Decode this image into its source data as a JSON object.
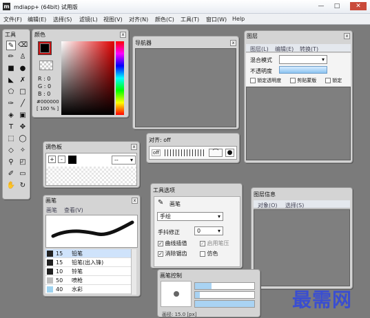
{
  "window": {
    "title": "mdiapp+ (64bit) 试用版",
    "icon_letter": "m",
    "minimize": "—",
    "maximize": "□",
    "close": "✕"
  },
  "menu": [
    "文件(F)",
    "编辑(E)",
    "选择(S)",
    "滤镜(L)",
    "视图(V)",
    "对齐(N)",
    "颜色(C)",
    "工具(T)",
    "窗口(W)",
    "Help"
  ],
  "tools_panel": {
    "title": "工具"
  },
  "color_panel": {
    "title": "颜色",
    "r": "R : 0",
    "g": "G : 0",
    "b": "B : 0",
    "hex": "#000000",
    "opacity": "[ 100 % ]"
  },
  "navigator": {
    "title": "导航器"
  },
  "layers": {
    "title": "图层",
    "tabs": [
      "图层(L)",
      "编辑(E)",
      "转换(T)"
    ],
    "blend_label": "混合模式",
    "opacity_label": "不透明度",
    "checks": [
      "锁定透明度",
      "剪贴蒙版",
      "锁定"
    ]
  },
  "align": {
    "title": "对齐: off",
    "off_label": "off"
  },
  "palette": {
    "title": "调色板",
    "plus": "+",
    "minus": "-",
    "dropdown": "--"
  },
  "tool_options": {
    "title": "工具选项",
    "tool_name": "画笔",
    "mode": "手绘",
    "stabilizer_label": "手抖修正",
    "stabilizer_value": "0",
    "check1": "曲线插值",
    "check2": "启用笔压",
    "check3": "消除锯齿",
    "check4": "仿色"
  },
  "layer_info": {
    "title": "图层信息",
    "tabs": [
      "对象(O)",
      "选择(S)"
    ]
  },
  "brush": {
    "title": "画笔",
    "tabs": [
      "画笔",
      "查看(V)"
    ],
    "items": [
      {
        "size": "15",
        "name": "铅笔",
        "color": "#202020",
        "selected": true
      },
      {
        "size": "15",
        "name": "铅笔(出入锋)",
        "color": "#202020",
        "selected": false
      },
      {
        "size": "10",
        "name": "铃笔",
        "color": "#202020",
        "selected": false
      },
      {
        "size": "50",
        "name": "喷枪",
        "color": "#bdbdbd",
        "selected": false
      },
      {
        "size": "40",
        "name": "水彩",
        "color": "#9fd3f0",
        "selected": false
      }
    ]
  },
  "brush_control": {
    "title": "画笔控制",
    "size_text": "画径: 15.0 [px]"
  },
  "watermark": "最需网"
}
